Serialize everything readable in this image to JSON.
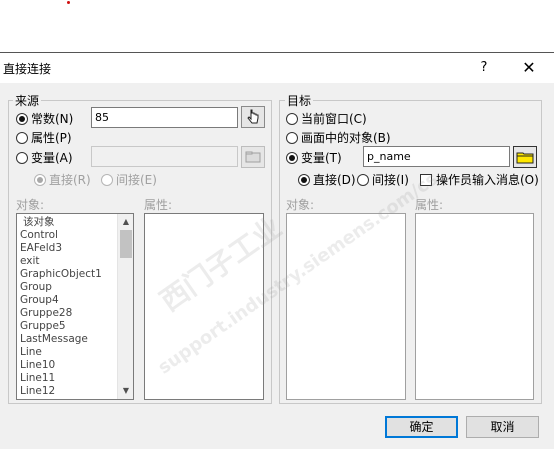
{
  "dialog": {
    "title": "直接连接",
    "help_label": "?",
    "close_label": "✕"
  },
  "source": {
    "group_label": "来源",
    "constant_label": "常数(N)",
    "constant_value": "85",
    "property_label": "属性(P)",
    "variable_label": "变量(A)",
    "variable_value": "",
    "direct_label": "直接(R)",
    "indirect_label": "间接(E)",
    "object_label": "对象:",
    "attribute_label": "属性:",
    "objects": [
      "该对象",
      "Control",
      "EAFeld3",
      "exit",
      "GraphicObject1",
      "Group",
      "Group4",
      "Gruppe28",
      "Gruppe5",
      "LastMessage",
      "Line",
      "Line10",
      "Line11",
      "Line12"
    ]
  },
  "target": {
    "group_label": "目标",
    "current_window_label": "当前窗口(C)",
    "object_in_screen_label": "画面中的对象(B)",
    "variable_label": "变量(T)",
    "variable_value": "p_name",
    "direct_label": "直接(D)",
    "indirect_label": "间接(I)",
    "operator_input_label": "操作员输入消息(O)",
    "object_label": "对象:",
    "attribute_label": "属性:"
  },
  "buttons": {
    "ok_label": "确定",
    "cancel_label": "取消"
  },
  "watermark": {
    "line1": "西门子工业",
    "line2": "support.industry.siemens.com/cs"
  }
}
